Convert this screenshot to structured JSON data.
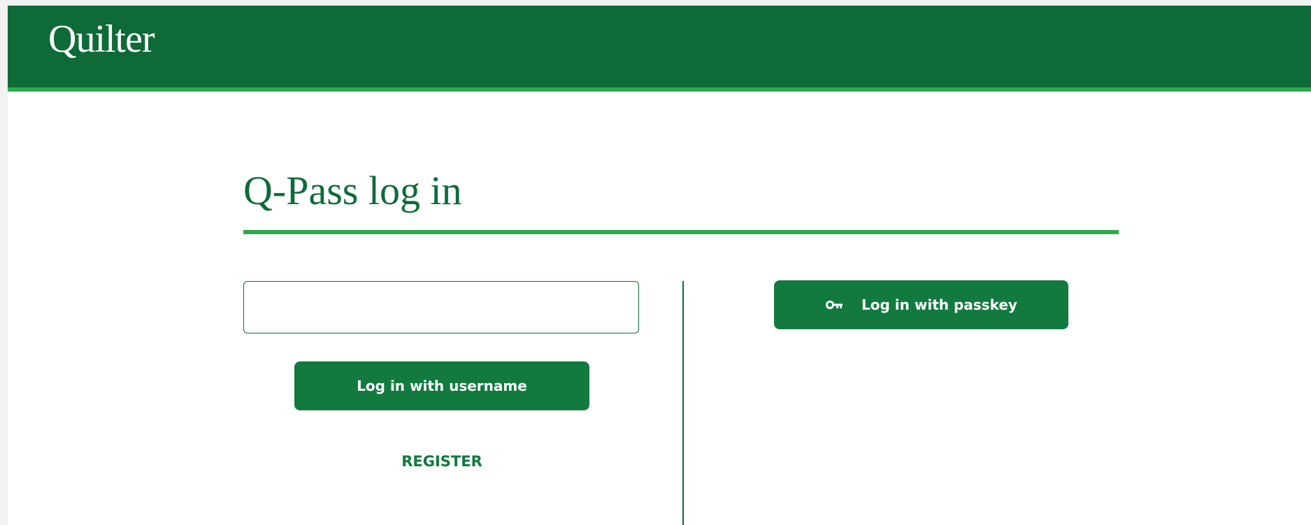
{
  "header": {
    "logo_text": "Quilter"
  },
  "login": {
    "title": "Q-Pass log in",
    "username_input": {
      "value": "",
      "placeholder": ""
    },
    "username_button_label": "Log in with username",
    "register_label": "REGISTER",
    "passkey_button_label": "Log in with passkey",
    "passkey_icon": "key-icon"
  },
  "colors": {
    "header_bg": "#0e6b38",
    "accent_rule": "#2bab49",
    "button_bg": "#127a3f",
    "text_green": "#0e6b38"
  }
}
